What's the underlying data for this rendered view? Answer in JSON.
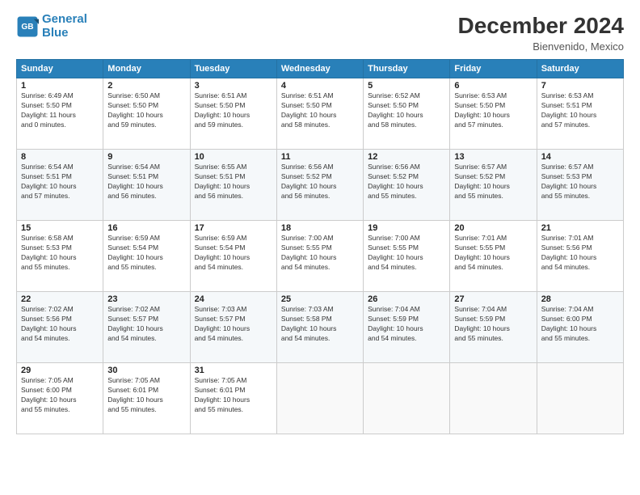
{
  "logo": {
    "line1": "General",
    "line2": "Blue"
  },
  "header": {
    "title": "December 2024",
    "location": "Bienvenido, Mexico"
  },
  "weekdays": [
    "Sunday",
    "Monday",
    "Tuesday",
    "Wednesday",
    "Thursday",
    "Friday",
    "Saturday"
  ],
  "weeks": [
    [
      {
        "day": "1",
        "info": "Sunrise: 6:49 AM\nSunset: 5:50 PM\nDaylight: 11 hours\nand 0 minutes."
      },
      {
        "day": "2",
        "info": "Sunrise: 6:50 AM\nSunset: 5:50 PM\nDaylight: 10 hours\nand 59 minutes."
      },
      {
        "day": "3",
        "info": "Sunrise: 6:51 AM\nSunset: 5:50 PM\nDaylight: 10 hours\nand 59 minutes."
      },
      {
        "day": "4",
        "info": "Sunrise: 6:51 AM\nSunset: 5:50 PM\nDaylight: 10 hours\nand 58 minutes."
      },
      {
        "day": "5",
        "info": "Sunrise: 6:52 AM\nSunset: 5:50 PM\nDaylight: 10 hours\nand 58 minutes."
      },
      {
        "day": "6",
        "info": "Sunrise: 6:53 AM\nSunset: 5:50 PM\nDaylight: 10 hours\nand 57 minutes."
      },
      {
        "day": "7",
        "info": "Sunrise: 6:53 AM\nSunset: 5:51 PM\nDaylight: 10 hours\nand 57 minutes."
      }
    ],
    [
      {
        "day": "8",
        "info": "Sunrise: 6:54 AM\nSunset: 5:51 PM\nDaylight: 10 hours\nand 57 minutes."
      },
      {
        "day": "9",
        "info": "Sunrise: 6:54 AM\nSunset: 5:51 PM\nDaylight: 10 hours\nand 56 minutes."
      },
      {
        "day": "10",
        "info": "Sunrise: 6:55 AM\nSunset: 5:51 PM\nDaylight: 10 hours\nand 56 minutes."
      },
      {
        "day": "11",
        "info": "Sunrise: 6:56 AM\nSunset: 5:52 PM\nDaylight: 10 hours\nand 56 minutes."
      },
      {
        "day": "12",
        "info": "Sunrise: 6:56 AM\nSunset: 5:52 PM\nDaylight: 10 hours\nand 55 minutes."
      },
      {
        "day": "13",
        "info": "Sunrise: 6:57 AM\nSunset: 5:52 PM\nDaylight: 10 hours\nand 55 minutes."
      },
      {
        "day": "14",
        "info": "Sunrise: 6:57 AM\nSunset: 5:53 PM\nDaylight: 10 hours\nand 55 minutes."
      }
    ],
    [
      {
        "day": "15",
        "info": "Sunrise: 6:58 AM\nSunset: 5:53 PM\nDaylight: 10 hours\nand 55 minutes."
      },
      {
        "day": "16",
        "info": "Sunrise: 6:59 AM\nSunset: 5:54 PM\nDaylight: 10 hours\nand 55 minutes."
      },
      {
        "day": "17",
        "info": "Sunrise: 6:59 AM\nSunset: 5:54 PM\nDaylight: 10 hours\nand 54 minutes."
      },
      {
        "day": "18",
        "info": "Sunrise: 7:00 AM\nSunset: 5:55 PM\nDaylight: 10 hours\nand 54 minutes."
      },
      {
        "day": "19",
        "info": "Sunrise: 7:00 AM\nSunset: 5:55 PM\nDaylight: 10 hours\nand 54 minutes."
      },
      {
        "day": "20",
        "info": "Sunrise: 7:01 AM\nSunset: 5:55 PM\nDaylight: 10 hours\nand 54 minutes."
      },
      {
        "day": "21",
        "info": "Sunrise: 7:01 AM\nSunset: 5:56 PM\nDaylight: 10 hours\nand 54 minutes."
      }
    ],
    [
      {
        "day": "22",
        "info": "Sunrise: 7:02 AM\nSunset: 5:56 PM\nDaylight: 10 hours\nand 54 minutes."
      },
      {
        "day": "23",
        "info": "Sunrise: 7:02 AM\nSunset: 5:57 PM\nDaylight: 10 hours\nand 54 minutes."
      },
      {
        "day": "24",
        "info": "Sunrise: 7:03 AM\nSunset: 5:57 PM\nDaylight: 10 hours\nand 54 minutes."
      },
      {
        "day": "25",
        "info": "Sunrise: 7:03 AM\nSunset: 5:58 PM\nDaylight: 10 hours\nand 54 minutes."
      },
      {
        "day": "26",
        "info": "Sunrise: 7:04 AM\nSunset: 5:59 PM\nDaylight: 10 hours\nand 54 minutes."
      },
      {
        "day": "27",
        "info": "Sunrise: 7:04 AM\nSunset: 5:59 PM\nDaylight: 10 hours\nand 55 minutes."
      },
      {
        "day": "28",
        "info": "Sunrise: 7:04 AM\nSunset: 6:00 PM\nDaylight: 10 hours\nand 55 minutes."
      }
    ],
    [
      {
        "day": "29",
        "info": "Sunrise: 7:05 AM\nSunset: 6:00 PM\nDaylight: 10 hours\nand 55 minutes."
      },
      {
        "day": "30",
        "info": "Sunrise: 7:05 AM\nSunset: 6:01 PM\nDaylight: 10 hours\nand 55 minutes."
      },
      {
        "day": "31",
        "info": "Sunrise: 7:05 AM\nSunset: 6:01 PM\nDaylight: 10 hours\nand 55 minutes."
      },
      {
        "day": "",
        "info": ""
      },
      {
        "day": "",
        "info": ""
      },
      {
        "day": "",
        "info": ""
      },
      {
        "day": "",
        "info": ""
      }
    ]
  ]
}
